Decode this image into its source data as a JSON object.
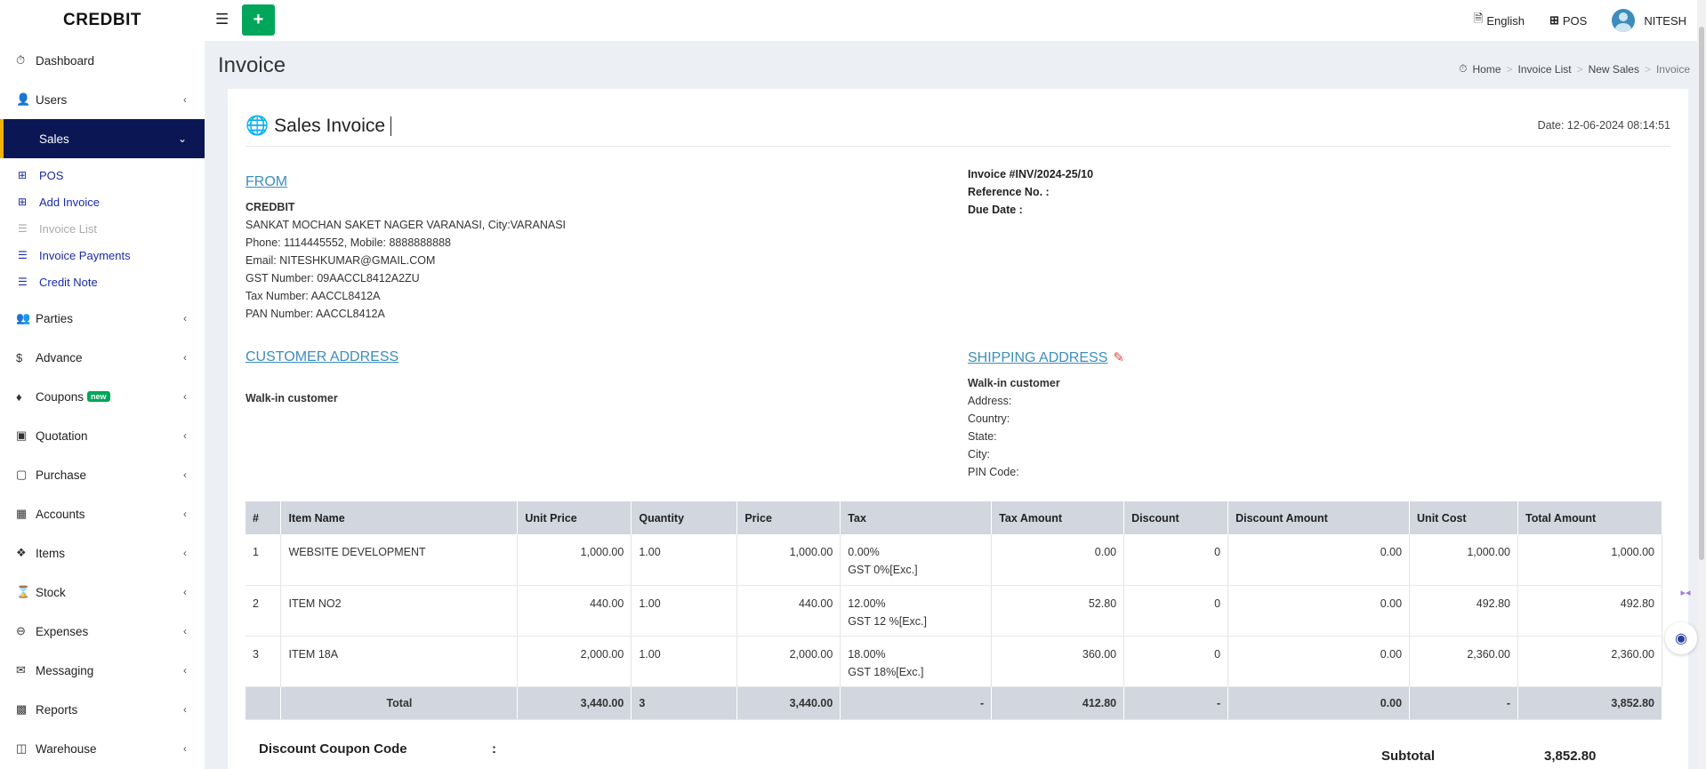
{
  "topbar": {
    "brand": "CREDBIT",
    "menu_icon": "hamburger-icon",
    "add_icon": "plus-icon",
    "language": "English",
    "pos": "POS",
    "user": "NITESH"
  },
  "sidebar": {
    "items": [
      {
        "label": "Dashboard",
        "icon": "dashboard-icon"
      },
      {
        "label": "Users",
        "icon": "users-icon"
      },
      {
        "label": "Sales",
        "icon": "sales-icon"
      },
      {
        "label": "Parties",
        "icon": "parties-icon"
      },
      {
        "label": "Advance",
        "icon": "dollar-icon"
      },
      {
        "label": "Coupons",
        "icon": "tags-icon",
        "badge": "new"
      },
      {
        "label": "Quotation",
        "icon": "calendar-icon"
      },
      {
        "label": "Purchase",
        "icon": "cube-icon"
      },
      {
        "label": "Accounts",
        "icon": "grid-icon"
      },
      {
        "label": "Items",
        "icon": "cubes-icon"
      },
      {
        "label": "Stock",
        "icon": "hourglass-icon"
      },
      {
        "label": "Expenses",
        "icon": "minus-circle-icon"
      },
      {
        "label": "Messaging",
        "icon": "envelope-icon"
      },
      {
        "label": "Reports",
        "icon": "bar-chart-icon"
      },
      {
        "label": "Warehouse",
        "icon": "building-icon"
      }
    ],
    "sales_sub": [
      {
        "label": "POS"
      },
      {
        "label": "Add Invoice"
      },
      {
        "label": "Invoice List"
      },
      {
        "label": "Invoice Payments"
      },
      {
        "label": "Credit Note"
      }
    ]
  },
  "header": {
    "title": "Invoice",
    "breadcrumb": [
      "Home",
      "Invoice List",
      "New Sales",
      "Invoice"
    ]
  },
  "invoice": {
    "title": "Sales Invoice",
    "date": "Date: 12-06-2024 08:14:51",
    "from_heading": "FROM",
    "from_name": "CREDBIT",
    "from_address": "SANKAT MOCHAN SAKET NAGER VARANASI, City:VARANASI",
    "from_phone": "Phone: 1114445552, Mobile: 8888888888",
    "from_email": "Email: NITESHKUMAR@GMAIL.COM",
    "from_gst": "GST Number: 09AACCL8412A2ZU",
    "from_tax": "Tax Number: AACCL8412A",
    "from_pan": "PAN Number: AACCL8412A",
    "invoice_no": "Invoice #INV/2024-25/10",
    "reference": "Reference No. :",
    "due_date": "Due Date :",
    "customer_heading": "CUSTOMER ADDRESS",
    "customer_name": "Walk-in customer",
    "shipping_heading": "SHIPPING ADDRESS",
    "ship_name": "Walk-in customer",
    "ship_address": "Address:",
    "ship_country": "Country:",
    "ship_state": "State:",
    "ship_city": "City:",
    "ship_pin": "PIN Code:"
  },
  "table": {
    "headers": [
      "#",
      "Item Name",
      "Unit Price",
      "Quantity",
      "Price",
      "Tax",
      "Tax Amount",
      "Discount",
      "Discount Amount",
      "Unit Cost",
      "Total Amount"
    ],
    "rows": [
      {
        "no": "1",
        "name": "WEBSITE DEVELOPMENT",
        "unit_price": "1,000.00",
        "qty": "1.00",
        "price": "1,000.00",
        "tax_rate": "0.00%",
        "tax_type": "GST 0%[Exc.]",
        "tax_amount": "0.00",
        "discount": "0",
        "discount_amount": "0.00",
        "unit_cost": "1,000.00",
        "total": "1,000.00"
      },
      {
        "no": "2",
        "name": "ITEM NO2",
        "unit_price": "440.00",
        "qty": "1.00",
        "price": "440.00",
        "tax_rate": "12.00%",
        "tax_type": "GST 12 %[Exc.]",
        "tax_amount": "52.80",
        "discount": "0",
        "discount_amount": "0.00",
        "unit_cost": "492.80",
        "total": "492.80"
      },
      {
        "no": "3",
        "name": "ITEM 18A",
        "unit_price": "2,000.00",
        "qty": "1.00",
        "price": "2,000.00",
        "tax_rate": "18.00%",
        "tax_type": "GST 18%[Exc.]",
        "tax_amount": "360.00",
        "discount": "0",
        "discount_amount": "0.00",
        "unit_cost": "2,360.00",
        "total": "2,360.00"
      }
    ],
    "total": {
      "label": "Total",
      "unit_price": "3,440.00",
      "qty": "3",
      "price": "3,440.00",
      "tax": "-",
      "tax_amount": "412.80",
      "discount": "-",
      "discount_amount": "0.00",
      "unit_cost": "-",
      "total": "3,852.80"
    }
  },
  "footer": {
    "coupon_label": "Discount Coupon Code",
    "coupon_colon": ":",
    "subtotal_label": "Subtotal",
    "subtotal_value": "3,852.80"
  }
}
